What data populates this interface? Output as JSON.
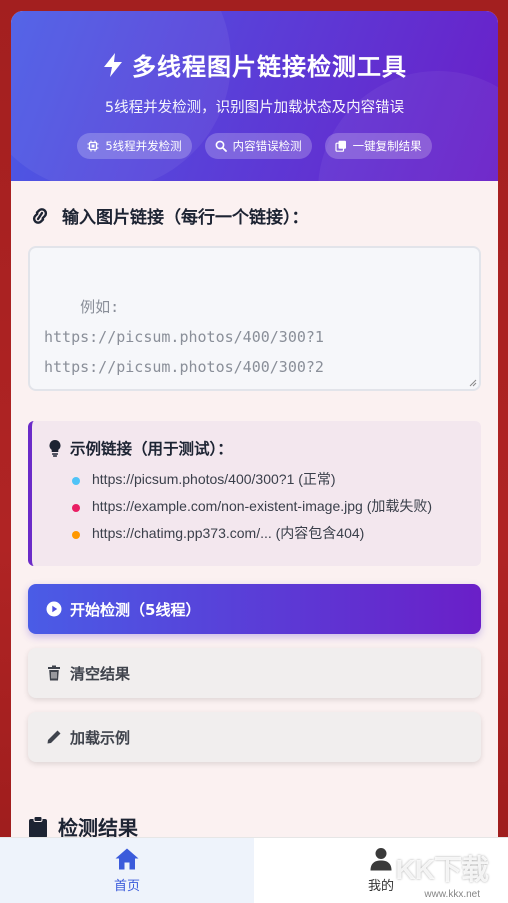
{
  "header": {
    "title": "多线程图片链接检测工具",
    "subtitle": "5线程并发检测，识别图片加载状态及内容错误",
    "chips": [
      {
        "icon": "cpu-icon",
        "label": "5线程并发检测"
      },
      {
        "icon": "search-icon",
        "label": "内容错误检测"
      },
      {
        "icon": "copy-icon",
        "label": "一键复制结果"
      }
    ]
  },
  "input_section": {
    "label": "输入图片链接（每行一个链接）：",
    "placeholder": "例如:\nhttps://picsum.photos/400/300?1\nhttps://picsum.photos/400/300?2\nhttps://example.com/non-existent-image.jpg"
  },
  "examples": {
    "title": "示例链接（用于测试）：",
    "items": [
      {
        "text": "https://picsum.photos/400/300?1 (正常)",
        "color": "#4fc3f7"
      },
      {
        "text": "https://example.com/non-existent-image.jpg (加载失败)",
        "color": "#e91e63"
      },
      {
        "text": "https://chatimg.pp373.com/... (内容包含404)",
        "color": "#ff9800"
      }
    ]
  },
  "buttons": {
    "start": "开始检测（5线程）",
    "clear": "清空结果",
    "load_example": "加载示例"
  },
  "results": {
    "title": "检测结果"
  },
  "bottom_nav": [
    {
      "icon": "home-icon",
      "label": "首页",
      "active": true
    },
    {
      "icon": "user-icon",
      "label": "我的",
      "active": false
    }
  ],
  "watermark": {
    "text": "KK下载",
    "url": "www.kkx.net"
  },
  "colors": {
    "accent_start": "#4a5ce6",
    "accent_end": "#6a1fc8",
    "background": "#a31f1f"
  }
}
